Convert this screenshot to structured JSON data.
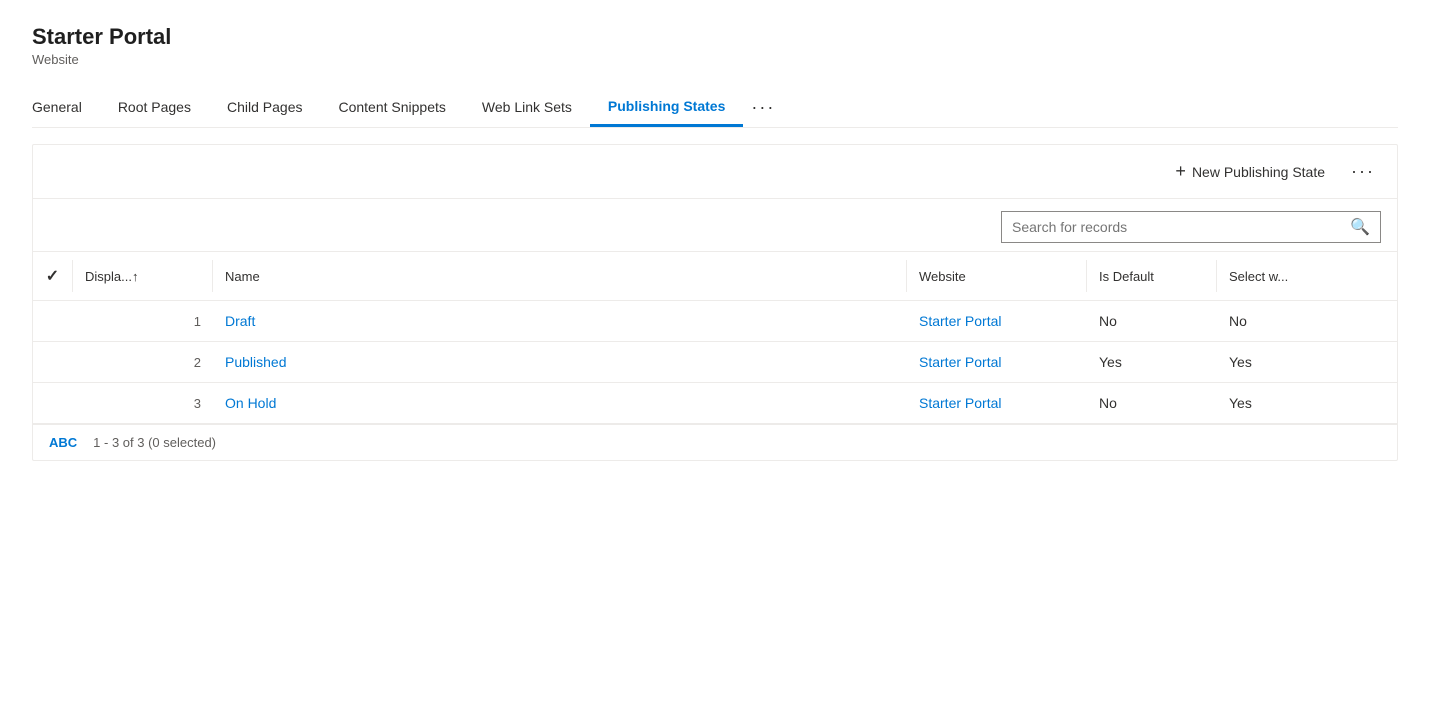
{
  "header": {
    "title": "Starter Portal",
    "subtitle": "Website"
  },
  "tabs": [
    {
      "id": "general",
      "label": "General",
      "active": false
    },
    {
      "id": "root-pages",
      "label": "Root Pages",
      "active": false
    },
    {
      "id": "child-pages",
      "label": "Child Pages",
      "active": false
    },
    {
      "id": "content-snippets",
      "label": "Content Snippets",
      "active": false
    },
    {
      "id": "web-link-sets",
      "label": "Web Link Sets",
      "active": false
    },
    {
      "id": "publishing-states",
      "label": "Publishing States",
      "active": true
    }
  ],
  "more_tab_label": "···",
  "toolbar": {
    "new_button_label": "New Publishing State",
    "more_label": "···"
  },
  "search": {
    "placeholder": "Search for records"
  },
  "table": {
    "columns": [
      {
        "id": "check",
        "label": "✓"
      },
      {
        "id": "display",
        "label": "Displa...↑"
      },
      {
        "id": "name",
        "label": "Name"
      },
      {
        "id": "website",
        "label": "Website"
      },
      {
        "id": "is_default",
        "label": "Is Default"
      },
      {
        "id": "select_w",
        "label": "Select w..."
      }
    ],
    "rows": [
      {
        "num": "1",
        "name": "Draft",
        "website": "Starter Portal",
        "is_default": "No",
        "select_w": "No"
      },
      {
        "num": "2",
        "name": "Published",
        "website": "Starter Portal",
        "is_default": "Yes",
        "select_w": "Yes"
      },
      {
        "num": "3",
        "name": "On Hold",
        "website": "Starter Portal",
        "is_default": "No",
        "select_w": "Yes"
      }
    ]
  },
  "footer": {
    "abc_label": "ABC",
    "count_label": "1 - 3 of 3 (0 selected)"
  }
}
